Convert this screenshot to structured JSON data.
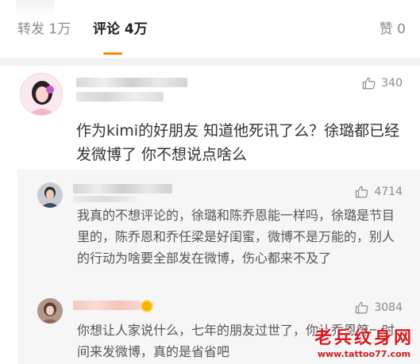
{
  "tabs": {
    "repost": "转发 1万",
    "comment": "评论 4万",
    "like": "赞 0"
  },
  "comment": {
    "likes": "340",
    "text": "作为kimi的好朋友 知道他死讯了么？徐璐都已经发微博了 你不想说点啥么"
  },
  "replies": [
    {
      "likes": "4714",
      "text": "我真的不想评论的，徐璐和陈乔恩能一样吗，徐璐是节目里的，陈乔恩和乔任梁是好闺蜜，微博不是万能的，别人的行动为啥要全部发在微博，伤心都来不及了"
    },
    {
      "likes": "3084",
      "text": "你想让人家说什么，七年的朋友过世了，你让乔恩第一时间来发微博，真的是省省吧"
    }
  ],
  "watermark": {
    "title": "老兵纹身网",
    "url": "www.tattoo77.com"
  },
  "colors": {
    "accent": "#ff8200",
    "watermark": "#d4181d",
    "reply_bg": "#f6f6f6"
  },
  "icons": [
    "thumbs-up-icon"
  ]
}
